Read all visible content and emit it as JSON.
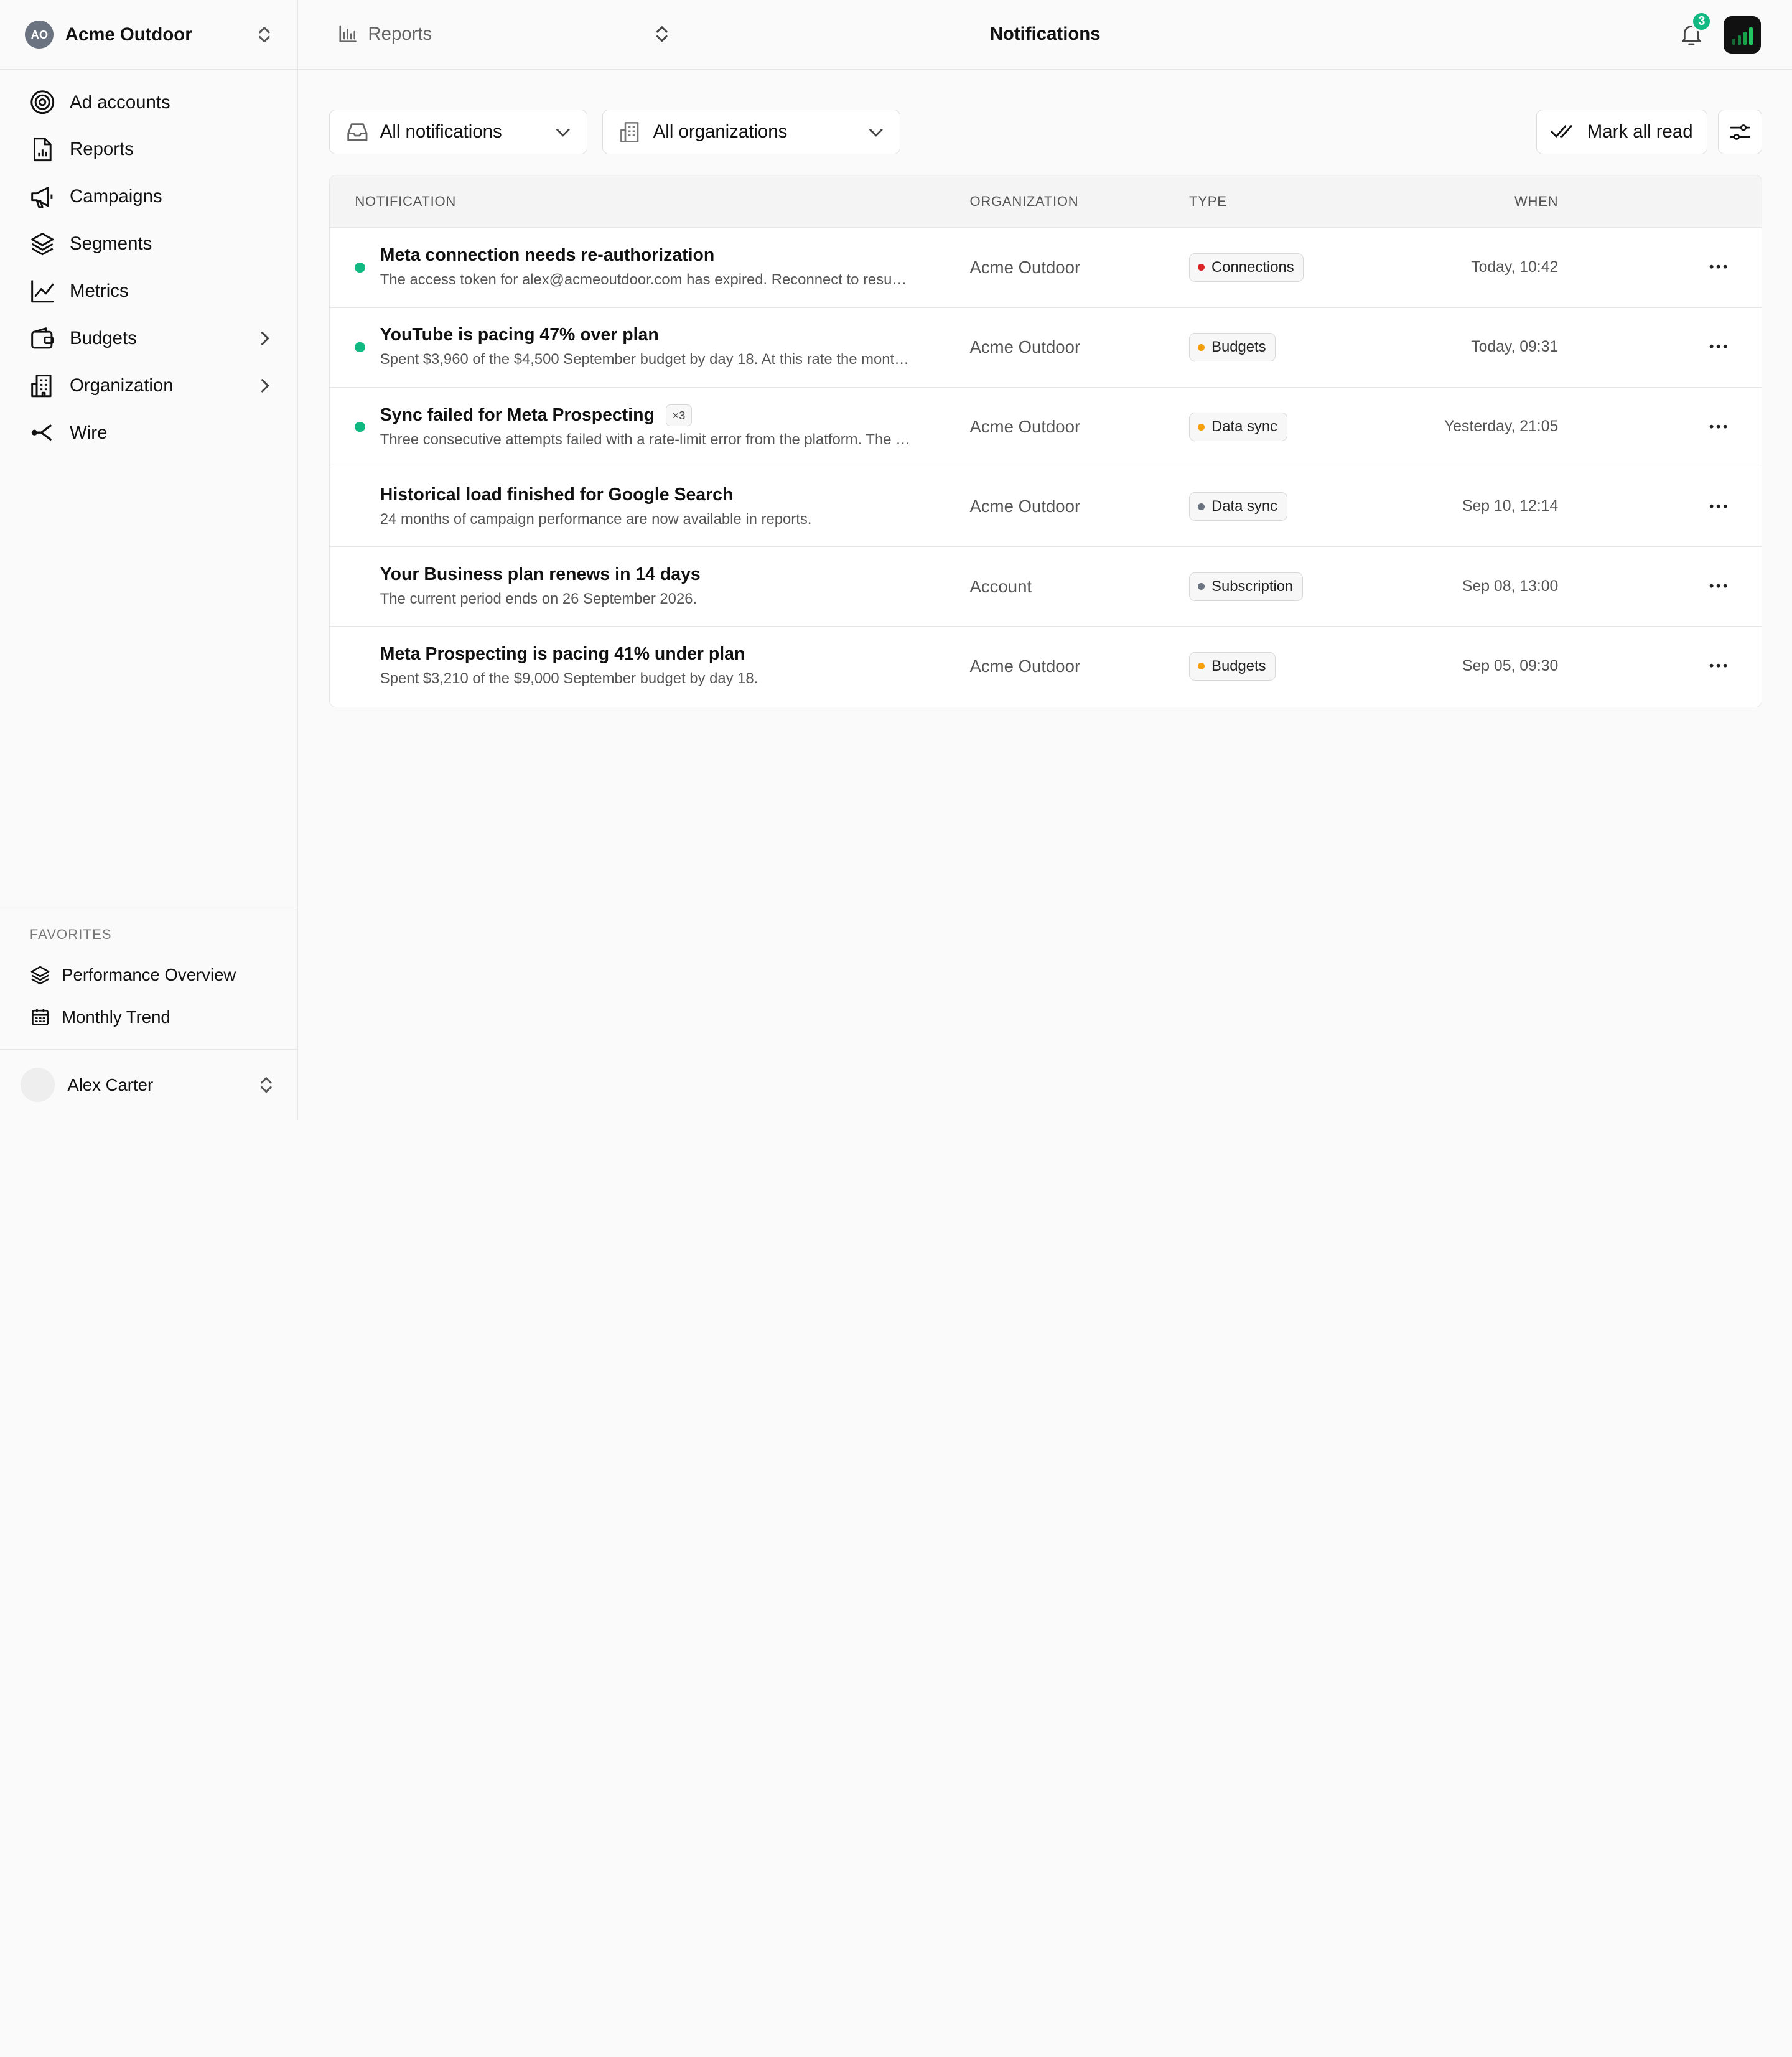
{
  "org": {
    "initials": "AO",
    "name": "Acme Outdoor"
  },
  "nav": [
    {
      "label": "Ad accounts",
      "icon": "target-icon"
    },
    {
      "label": "Reports",
      "icon": "report-icon"
    },
    {
      "label": "Campaigns",
      "icon": "megaphone-icon"
    },
    {
      "label": "Segments",
      "icon": "layers-icon"
    },
    {
      "label": "Metrics",
      "icon": "line-chart-icon"
    },
    {
      "label": "Budgets",
      "icon": "wallet-icon",
      "expandable": true
    },
    {
      "label": "Organization",
      "icon": "building-icon",
      "expandable": true
    },
    {
      "label": "Wire",
      "icon": "share-icon"
    }
  ],
  "favorites": {
    "title": "FAVORITES",
    "items": [
      {
        "label": "Performance Overview",
        "icon": "layers-icon"
      },
      {
        "label": "Monthly Trend",
        "icon": "calendar-icon"
      }
    ]
  },
  "user": {
    "name": "Alex Carter"
  },
  "topbar": {
    "breadcrumb": "Reports",
    "title": "Notifications",
    "notification_count": "3"
  },
  "filters": {
    "notifications": "All notifications",
    "organizations": "All organizations",
    "mark_all_read": "Mark all read"
  },
  "table": {
    "headers": {
      "notification": "NOTIFICATION",
      "organization": "ORGANIZATION",
      "type": "TYPE",
      "when": "WHEN"
    },
    "rows": [
      {
        "unread": true,
        "title": "Meta connection needs re-authorization",
        "count": "",
        "desc": "The access token for alex@acmeoutdoor.com has expired. Reconnect to resume syncing.",
        "org": "Acme Outdoor",
        "type": "Connections",
        "type_color": "#dc2626",
        "when": "Today, 10:42"
      },
      {
        "unread": true,
        "title": "YouTube is pacing 47% over plan",
        "count": "",
        "desc": "Spent $3,960 of the $4,500 September budget by day 18. At this rate the month will overspend.",
        "org": "Acme Outdoor",
        "type": "Budgets",
        "type_color": "#f59e0b",
        "when": "Today, 09:31"
      },
      {
        "unread": true,
        "title": "Sync failed for Meta Prospecting",
        "count": "×3",
        "desc": "Three consecutive attempts failed with a rate-limit error from the platform. The next retry is scheduled.",
        "org": "Acme Outdoor",
        "type": "Data sync",
        "type_color": "#f59e0b",
        "when": "Yesterday, 21:05"
      },
      {
        "unread": false,
        "title": "Historical load finished for Google Search",
        "count": "",
        "desc": "24 months of campaign performance are now available in reports.",
        "org": "Acme Outdoor",
        "type": "Data sync",
        "type_color": "#6b7280",
        "when": "Sep 10, 12:14"
      },
      {
        "unread": false,
        "title": "Your Business plan renews in 14 days",
        "count": "",
        "desc": "The current period ends on 26 September 2026.",
        "org": "Account",
        "type": "Subscription",
        "type_color": "#6b7280",
        "when": "Sep 08, 13:00"
      },
      {
        "unread": false,
        "title": "Meta Prospecting is pacing 41% under plan",
        "count": "",
        "desc": "Spent $3,210 of the $9,000 September budget by day 18.",
        "org": "Acme Outdoor",
        "type": "Budgets",
        "type_color": "#f59e0b",
        "when": "Sep 05, 09:30"
      }
    ]
  },
  "colors": {
    "accent": "#10b981",
    "border": "#e6e6e6"
  }
}
